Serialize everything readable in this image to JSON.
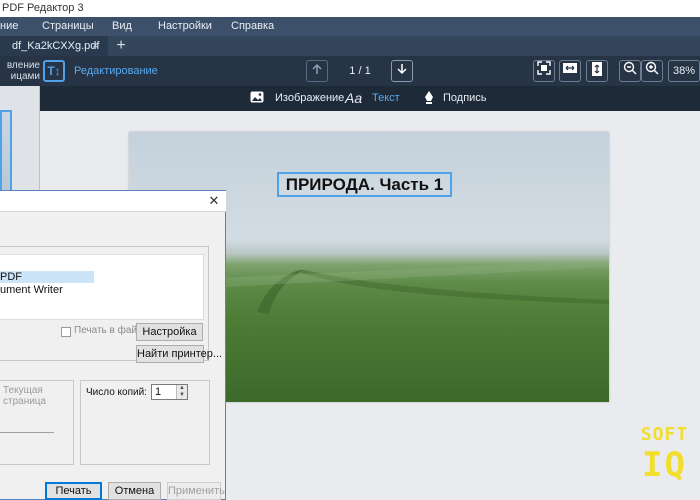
{
  "window": {
    "title": "PDF Редактор 3"
  },
  "menu": {
    "items": [
      "ние",
      "Страницы",
      "Вид",
      "Настройки",
      "Справка"
    ]
  },
  "tabs": {
    "active": "df_Ka2kCXXg.pdf",
    "close": "×",
    "add": "+"
  },
  "toolbar": {
    "side_label_1": "вление",
    "side_label_2": "ицами",
    "edit_icon": "T↕",
    "edit_label": "Редактирование",
    "page_indicator": "1 / 1",
    "zoom": "38%",
    "icons": [
      "nav-up-icon",
      "nav-down-icon",
      "fit-page-icon",
      "fit-width-icon",
      "fit-height-icon",
      "zoom-out-icon",
      "zoom-in-icon"
    ]
  },
  "subtoolbar": {
    "image_label": "Изображение",
    "text_icon": "Aa",
    "text_label": "Текст",
    "signature_label": "Подпись"
  },
  "document": {
    "title_text": "ПРИРОДА. Часть 1"
  },
  "print_dialog": {
    "close": "✕",
    "printers": [
      "PDF",
      "ument Writer"
    ],
    "print_to_file_label": "Печать в файл",
    "settings_button": "Настройка",
    "find_printer_button": "Найти принтер...",
    "range_current_1": "Текущая",
    "range_current_2": "страница",
    "copies_label": "Число копий:",
    "copies_value": "1",
    "print_button": "Печать",
    "cancel_button": "Отмена",
    "apply_button": "Применить"
  },
  "watermark": {
    "line1": "SOFT",
    "line2": "IQ"
  },
  "colors": {
    "accent": "#4ea2ea",
    "menubar": "#3d5069",
    "toolbar": "#263445",
    "watermark": "#f2de2c"
  }
}
